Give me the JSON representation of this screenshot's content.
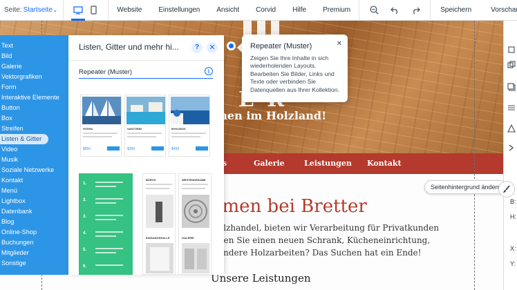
{
  "topbar": {
    "site_label": "Seite:",
    "site_name": "Startseite",
    "menu": [
      "Website",
      "Einstellungen",
      "Ansicht",
      "Corvid",
      "Hilfe",
      "Premium"
    ],
    "save": "Speichern",
    "preview": "Vorschau"
  },
  "hero": {
    "title": "E    R",
    "subtitle": "men im Holzland!"
  },
  "nav": {
    "items": [
      "s",
      "Galerie",
      "Leistungen",
      "Kontakt"
    ]
  },
  "content": {
    "heading": "amen bei Bretter",
    "lines": [
      "olzhandel, bieten wir Verarbeitung für Privatkunden",
      "gen Sie einen neuen Schrank, Kücheneinrichtung,",
      "andere Holzarbeiten? Das Suchen hat ein Ende!"
    ],
    "subheading": "Unsere Leistungen",
    "bg_button": "Seitenhintergrund ändern"
  },
  "add_panel": {
    "categories": [
      "Text",
      "Bild",
      "Galerie",
      "Vektorgrafiken",
      "Form",
      "Interaktive Elemente",
      "Button",
      "Box",
      "Streifen",
      "Listen & Gitter",
      "Video",
      "Musik",
      "Soziale Netzwerke",
      "Kontakt",
      "Menü",
      "Lightbox",
      "Datenbank",
      "Blog",
      "Online-Shop",
      "Buchungen",
      "Mitglieder",
      "Sonstige"
    ],
    "active_category": "Listen & Gitter",
    "title": "Listen, Gitter und mehr hi...",
    "help": "?",
    "section": "Repeater (Muster)",
    "repeater_cards": [
      {
        "caption": "HYDRA",
        "price": "$550"
      },
      {
        "caption": "SANTORIN",
        "price": "$399"
      },
      {
        "caption": "MYKONOS",
        "price": "$499"
      }
    ],
    "green_numbers": [
      "1.",
      "2.",
      "3.",
      "4.",
      "5.",
      "6."
    ],
    "gray_cards": [
      "BÜROS",
      "WESTENDRÄUME",
      "EINGANGSHALLE",
      "GALERIE"
    ]
  },
  "tooltip": {
    "title": "Repeater (Muster)",
    "body": "Zeigen Sie Ihre Inhalte in sich wiederholenden Layouts. Bearbeiten Sie Bilder, Links und Texte oder verbinden Sie Datenquellen aus Ihrer Kollektion."
  },
  "right_strip": {
    "labels": [
      "B:",
      "H:",
      "X:",
      "Y:"
    ]
  },
  "colors": {
    "accent": "#116dff",
    "panel_blue": "#2d95e6",
    "nav_red": "#b33a2c",
    "green_card": "#35c282"
  }
}
